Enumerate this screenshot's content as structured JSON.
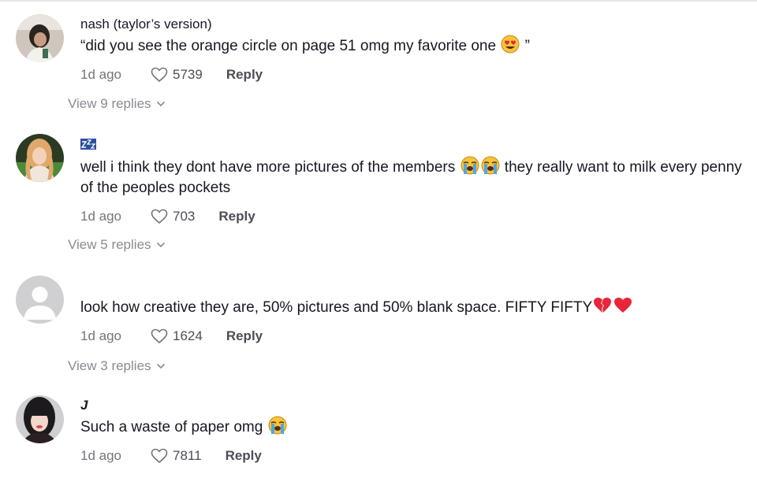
{
  "comments": [
    {
      "author": "nash (taylor’s version)",
      "text_pre": "“did you see the orange circle on page 51 omg my favorite one ",
      "text_post": " ”",
      "time": "1d ago",
      "likes": "5739",
      "reply": "Reply",
      "view_replies": "View 9 replies"
    },
    {
      "author": "",
      "text_pre": "well i think they dont have more pictures of the members ",
      "text_post": " they really want to milk every penny of the peoples pockets",
      "time": "1d ago",
      "likes": "703",
      "reply": "Reply",
      "view_replies": "View 5 replies"
    },
    {
      "author": "",
      "text_pre": "look how creative they are, 50% pictures and 50% blank space. FIFTY FIFTY",
      "time": "1d ago",
      "likes": "1624",
      "reply": "Reply",
      "view_replies": "View 3 replies"
    },
    {
      "author": "J",
      "text_pre": "Such a waste of paper omg ",
      "time": "1d ago",
      "likes": "7811",
      "reply": "Reply"
    }
  ],
  "icons": {
    "like": "heart-outline-icon",
    "expand": "chevron-down-icon"
  },
  "colors": {
    "text": "#161823",
    "muted": "#73757c",
    "default_avatar": "#d0d0d3"
  }
}
